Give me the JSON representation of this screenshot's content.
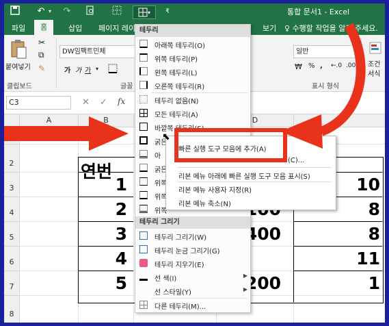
{
  "titlebar": {
    "title": "통합 문서1 - Excel",
    "qat": [
      "save-icon",
      "undo-icon",
      "redo-icon",
      "print-preview-icon",
      "grid-icon",
      "borders-icon",
      "dropdown-icon"
    ]
  },
  "tabs": {
    "file": "파일",
    "home": "홈",
    "insert": "삽입",
    "page_layout": "페이지 레이",
    "view": "보기",
    "tell_me": "수행할 작업을 알려 주세요."
  },
  "ribbon": {
    "paste_label": "붙여넣기",
    "clipboard_label": "클립보드",
    "font_name": "DW임팩트민체",
    "font_label": "글꼴",
    "number_format": "일반",
    "number_label": "표시 형식",
    "conditional_label": "조건",
    "styles_label": "서식"
  },
  "formula_bar": {
    "name_box": "C3",
    "fx": "fx"
  },
  "grid": {
    "columns": [
      "A",
      "B",
      "C",
      "D"
    ],
    "rows": [
      "1",
      "2",
      "3",
      "4",
      "5",
      "6",
      "7",
      "8"
    ],
    "header_cell": "연번",
    "serials": [
      "1",
      "2",
      "3",
      "4",
      "5"
    ],
    "col_d_values": [
      "100",
      "400",
      "200"
    ],
    "col_e_values": [
      "10",
      "8",
      "8",
      "11",
      "1"
    ]
  },
  "border_menu": {
    "header_borders": "테두리",
    "items": [
      "아래쪽 테두리(O)",
      "위쪽 테두리(P)",
      "왼쪽 테두리(L)",
      "오른쪽 테두리(R)",
      "테두리 없음(N)",
      "모든 테두리(A)",
      "바깥쪽 테두리(S)",
      "굵은",
      "아",
      "굵은",
      "위쪽",
      "위쪽",
      "위쪽"
    ],
    "header_draw": "테두리 그리기",
    "draw_items": [
      "테두리 그리기(W)",
      "테두리 눈금 그리기(G)",
      "테두리 지우기(E)",
      "선 색(I)",
      "선 스타일(Y)",
      "다른 테두리(M)..."
    ]
  },
  "context_menu": {
    "items": [
      "빠른 실행 도구 모음에 추가(A)",
      "(C)...",
      "리본 메뉴 아래에 빠른 실행 도구 모음 표시(S)",
      "리본 메뉴 사용자 지정(R)",
      "리본 메뉴 축소(N)"
    ]
  },
  "colors": {
    "excel_green": "#217346",
    "annotation_red": "#e8321b",
    "frame_blue": "#1a1f9c"
  }
}
